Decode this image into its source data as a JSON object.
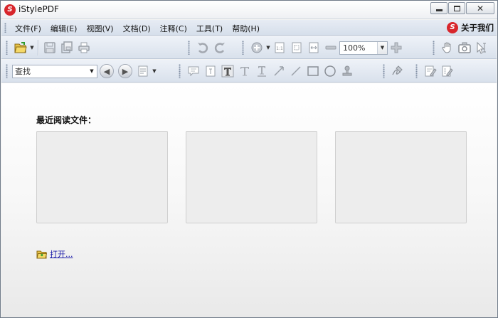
{
  "window": {
    "title": "iStylePDF",
    "app_logo_letter": "S"
  },
  "menu": {
    "items": [
      {
        "label": "文件(F)"
      },
      {
        "label": "编辑(E)"
      },
      {
        "label": "视图(V)"
      },
      {
        "label": "文档(D)"
      },
      {
        "label": "注释(C)"
      },
      {
        "label": "工具(T)"
      },
      {
        "label": "帮助(H)"
      }
    ],
    "about_label": "关于我们"
  },
  "toolbar": {
    "zoom_value": "100%",
    "search_value": "查找"
  },
  "main": {
    "recent_title": "最近阅读文件：",
    "open_label": "打开..."
  },
  "colors": {
    "brand_red": "#d8262c",
    "link_blue": "#1a1aa8"
  }
}
